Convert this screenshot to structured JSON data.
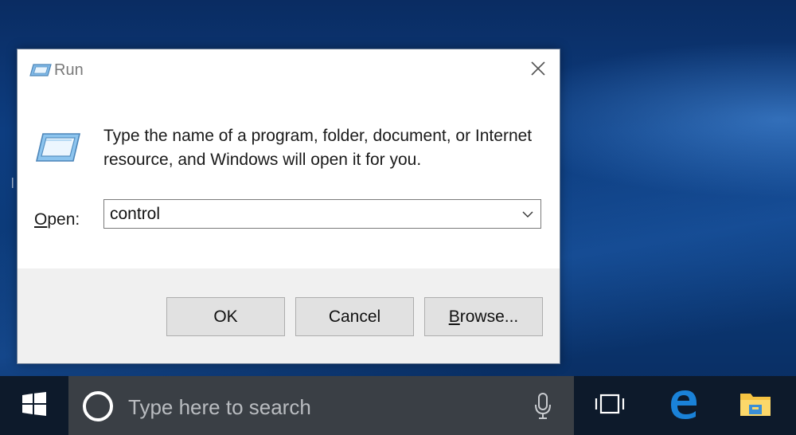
{
  "dialog": {
    "title": "Run",
    "description": "Type the name of a program, folder, document, or Internet resource, and Windows will open it for you.",
    "open_label_underlined": "O",
    "open_label_rest": "pen:",
    "input_value": "control",
    "ok_label": "OK",
    "cancel_label": "Cancel",
    "browse_label_underlined": "B",
    "browse_label_rest": "rowse..."
  },
  "taskbar": {
    "search_placeholder": "Type here to search"
  },
  "icons": {
    "title": "run-icon",
    "dialog": "run-icon",
    "close": "close-icon",
    "dropdown": "chevron-down-icon",
    "start": "windows-logo-icon",
    "cortana": "cortana-icon",
    "mic": "microphone-icon",
    "task_view": "task-view-icon",
    "edge": "edge-browser-icon",
    "explorer": "file-explorer-icon"
  },
  "colors": {
    "desktop": "#0c3a78",
    "taskbar": "#0d1a2b",
    "search_box": "#3a3f45",
    "button_face": "#e1e1e1",
    "footer": "#f0f0f0",
    "edge_blue": "#1a82d8",
    "folder_yellow": "#f5c342"
  }
}
